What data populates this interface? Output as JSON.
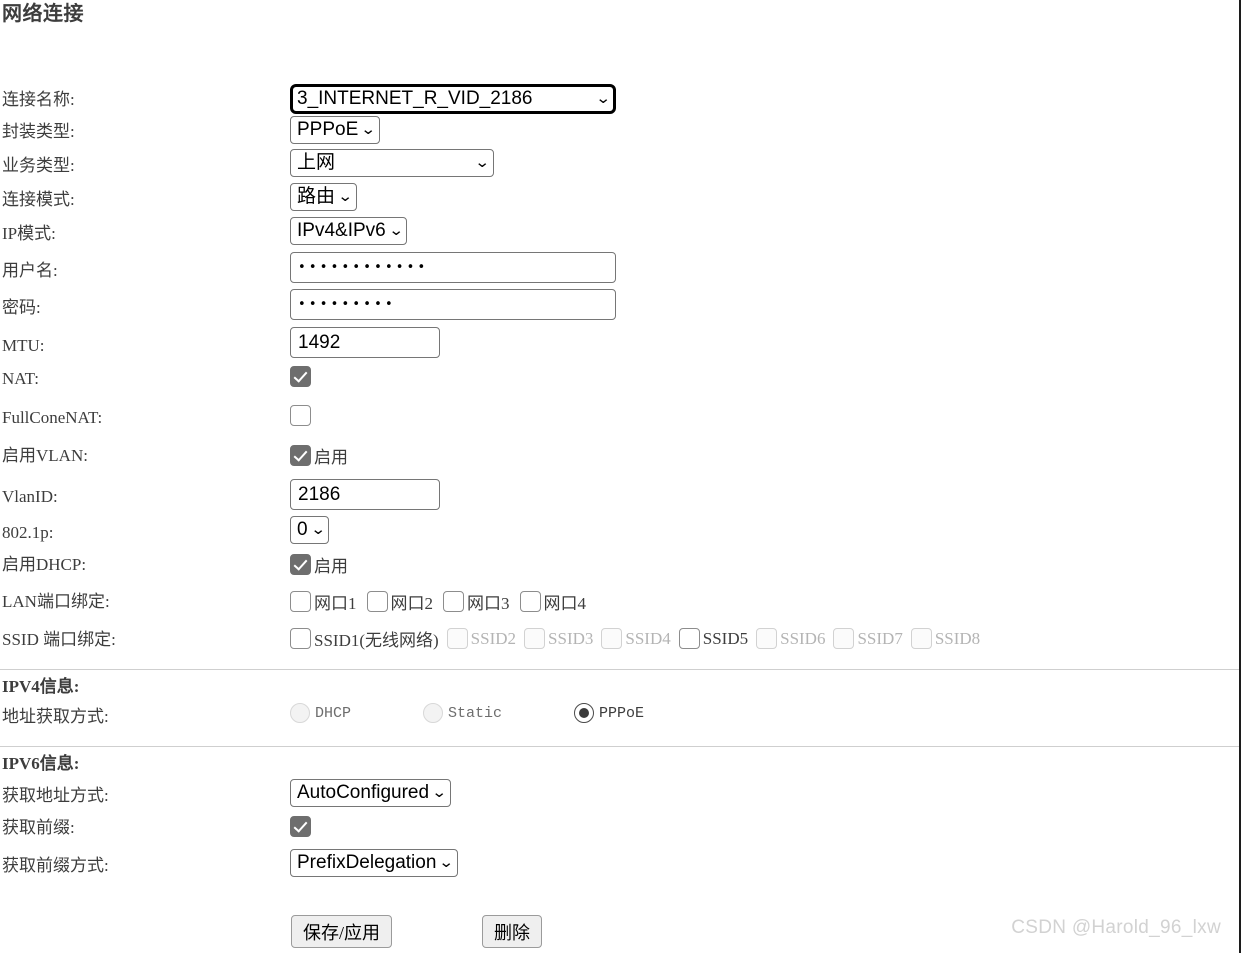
{
  "page": {
    "title": "网络连接",
    "watermark": "CSDN @Harold_96_lxw"
  },
  "fields": {
    "connection_name": {
      "label": "连接名称:",
      "value": "3_INTERNET_R_VID_2186"
    },
    "encapsulation": {
      "label": "封装类型:",
      "value": "PPPoE"
    },
    "service_type": {
      "label": "业务类型:",
      "value": "上网"
    },
    "connection_mode": {
      "label": "连接模式:",
      "value": "路由"
    },
    "ip_mode": {
      "label": "IP模式:",
      "value": "IPv4&IPv6"
    },
    "username": {
      "label": "用户名:",
      "value": "••••••••••••"
    },
    "password": {
      "label": "密码:",
      "value": "•••••••••"
    },
    "mtu": {
      "label": "MTU:",
      "value": "1492"
    },
    "nat": {
      "label": "NAT:",
      "checked": true
    },
    "fullconenat": {
      "label": "FullConeNAT:",
      "checked": false
    },
    "enable_vlan": {
      "label": "启用VLAN:",
      "checked": true,
      "text": "启用"
    },
    "vlan_id": {
      "label": "VlanID:",
      "value": "2186"
    },
    "dot1p": {
      "label": "802.1p:",
      "value": "0"
    },
    "enable_dhcp": {
      "label": "启用DHCP:",
      "checked": true,
      "text": "启用"
    },
    "lan_port_binding": {
      "label": "LAN端口绑定:",
      "ports": [
        {
          "text": "网口1",
          "checked": false,
          "disabled": false
        },
        {
          "text": "网口2",
          "checked": false,
          "disabled": false
        },
        {
          "text": "网口3",
          "checked": false,
          "disabled": false
        },
        {
          "text": "网口4",
          "checked": false,
          "disabled": false
        }
      ]
    },
    "ssid_port_binding": {
      "label": "SSID 端口绑定:",
      "ports": [
        {
          "text": "SSID1(无线网络)",
          "checked": false,
          "disabled": false
        },
        {
          "text": "SSID2",
          "checked": false,
          "disabled": true
        },
        {
          "text": "SSID3",
          "checked": false,
          "disabled": true
        },
        {
          "text": "SSID4",
          "checked": false,
          "disabled": true
        },
        {
          "text": "SSID5",
          "checked": false,
          "disabled": false
        },
        {
          "text": "SSID6",
          "checked": false,
          "disabled": true
        },
        {
          "text": "SSID7",
          "checked": false,
          "disabled": true
        },
        {
          "text": "SSID8",
          "checked": false,
          "disabled": true
        }
      ]
    }
  },
  "ipv4": {
    "section_label": "IPV4信息:",
    "addr_mode_label": "地址获取方式:",
    "options": [
      {
        "text": "DHCP",
        "selected": false,
        "disabled": true
      },
      {
        "text": "Static",
        "selected": false,
        "disabled": true
      },
      {
        "text": "PPPoE",
        "selected": true,
        "disabled": false
      }
    ]
  },
  "ipv6": {
    "section_label": "IPV6信息:",
    "addr_mode": {
      "label": "获取地址方式:",
      "value": "AutoConfigured"
    },
    "get_prefix": {
      "label": "获取前缀:",
      "checked": true
    },
    "prefix_mode": {
      "label": "获取前缀方式:",
      "value": "PrefixDelegation"
    }
  },
  "buttons": {
    "save": "保存/应用",
    "delete": "删除"
  },
  "icons": {
    "caret": "⌄"
  }
}
